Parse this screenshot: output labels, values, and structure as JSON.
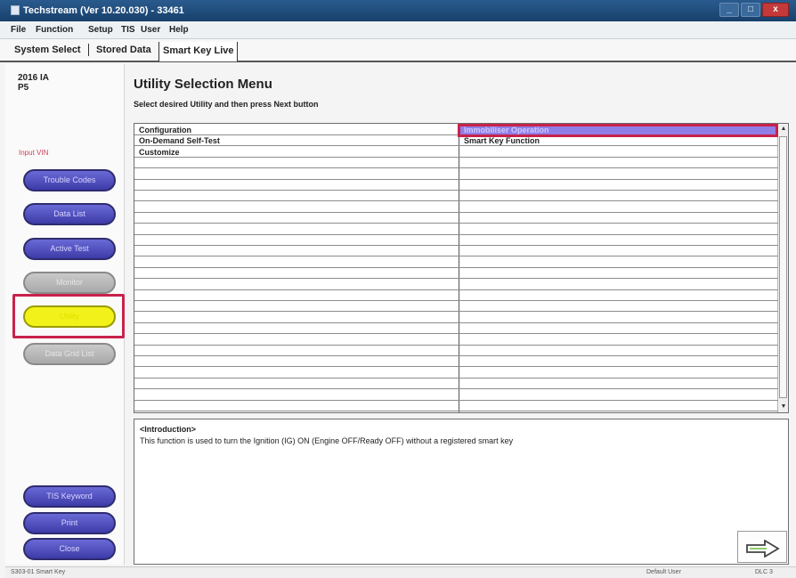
{
  "window": {
    "title": "Techstream (Ver 10.20.030) - 33461",
    "buttons": [
      "_",
      "□",
      "x"
    ]
  },
  "menubar": {
    "items": [
      "File",
      "Function",
      "Setup",
      "TIS",
      "User",
      "Help"
    ]
  },
  "tabs": [
    "System Select",
    "Stored Data",
    "Smart Key Live"
  ],
  "vehicle": {
    "year_code": "2016 IA",
    "model": "P5"
  },
  "sidebar": {
    "input_vin": "Input VIN",
    "buttons": [
      "Trouble Codes",
      "Data List",
      "Active Test",
      "Monitor",
      "Utility",
      "Data Grid List"
    ],
    "bottom_buttons": [
      "TIS Keyword",
      "Print",
      "Close"
    ]
  },
  "main": {
    "title": "Utility Selection Menu",
    "subtitle": "Select desired Utility and then press Next button",
    "left_items": [
      "Configuration",
      "On-Demand Self-Test",
      "Customize"
    ],
    "right_items": [
      "Immobiliser Operation",
      "Smart Key Function"
    ],
    "selected_right_index": 0
  },
  "intro": {
    "heading": "<Introduction>",
    "text": "This function is used to turn the Ignition (IG) ON (Engine OFF/Ready OFF) without a registered smart key"
  },
  "status": {
    "left": "S303-01  Smart Key",
    "middle": "Default User",
    "right": "DLC 3"
  },
  "colors": {
    "nav_button": "#4b49b8",
    "active_button": "#f2f21a",
    "highlight": "#c8224b",
    "selected_row": "#8f7ee6"
  }
}
